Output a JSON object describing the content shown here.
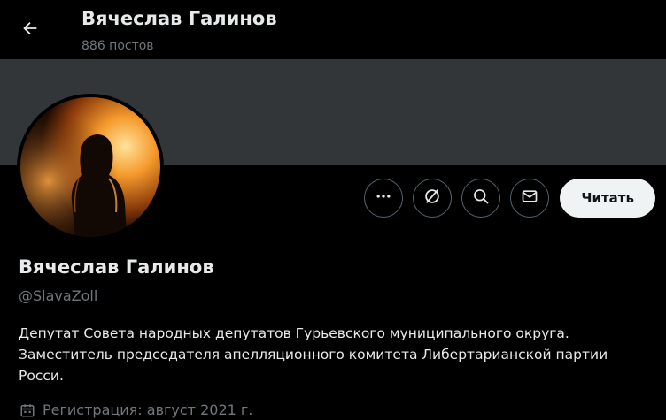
{
  "header": {
    "name": "Вячеслав Галинов",
    "posts": "886 постов"
  },
  "profile": {
    "name": "Вячеслав Галинов",
    "handle": "@SlavaZoll",
    "bio_lines": [
      "Депутат Совета народных депутатов Гурьевского муниципального округа.",
      "Заместитель председателя апелляционного комитета Либертарианской партии",
      "Росси."
    ],
    "joined": "Регистрация: август 2021 г."
  },
  "actions": {
    "follow_label": "Читать",
    "icons": [
      "more-icon",
      "grok-icon",
      "search-icon",
      "message-icon"
    ]
  },
  "colors": {
    "background": "#000000",
    "banner": "#333639",
    "secondary_text": "#71767b",
    "primary_text": "#e7e9ea",
    "follow_bg": "#eff3f4",
    "button_border": "#536471"
  }
}
